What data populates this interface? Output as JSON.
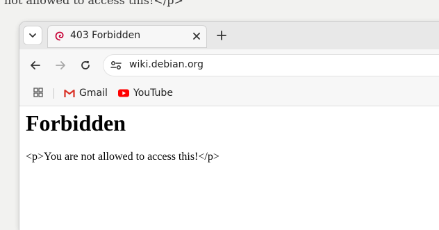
{
  "background": {
    "partial_text": "not allowed to access this!</p>"
  },
  "browser": {
    "tab": {
      "title": "403 Forbidden",
      "favicon": "debian-swirl-icon"
    },
    "address": {
      "url": "wiki.debian.org"
    },
    "bookmarks": [
      {
        "label": "Gmail",
        "icon": "gmail-icon"
      },
      {
        "label": "YouTube",
        "icon": "youtube-icon"
      }
    ],
    "colors": {
      "debian_red": "#c70036",
      "youtube_red": "#ff0000"
    }
  },
  "page": {
    "heading": "Forbidden",
    "body": "<p>You are not allowed to access this!</p>"
  }
}
